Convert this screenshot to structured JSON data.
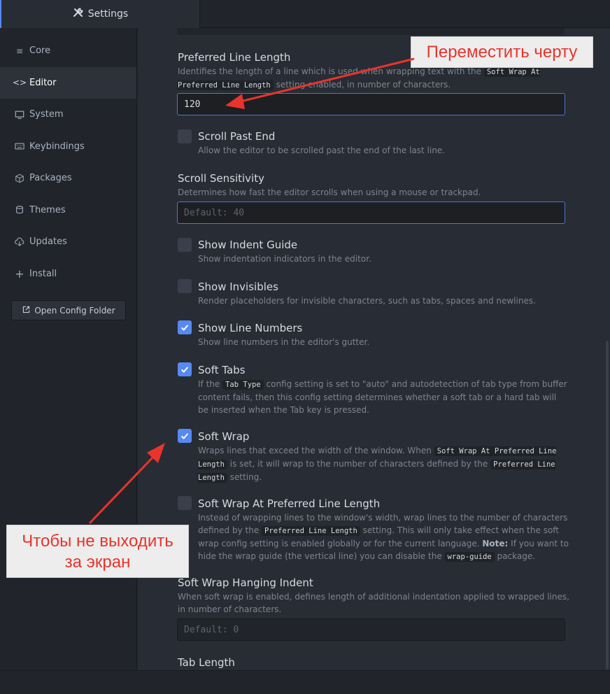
{
  "tab": {
    "label": "Settings"
  },
  "sidebar": {
    "items": [
      {
        "label": "Core",
        "icon": "sliders-icon"
      },
      {
        "label": "Editor",
        "icon": "code-icon"
      },
      {
        "label": "System",
        "icon": "monitor-icon"
      },
      {
        "label": "Keybindings",
        "icon": "keyboard-icon"
      },
      {
        "label": "Packages",
        "icon": "package-icon"
      },
      {
        "label": "Themes",
        "icon": "paintcan-icon"
      },
      {
        "label": "Updates",
        "icon": "cloud-download-icon"
      },
      {
        "label": "Install",
        "icon": "plus-icon"
      }
    ],
    "open_config": "Open Config Folder"
  },
  "settings": {
    "preferred_line_length": {
      "title": "Preferred Line Length",
      "desc_1": "Identifies the length of a line which is used when wrapping text with the",
      "code": "Soft Wrap At Preferred Line Length",
      "desc_2": "setting enabled, in number of characters.",
      "value": "120"
    },
    "scroll_past_end": {
      "title": "Scroll Past End",
      "desc": "Allow the editor to be scrolled past the end of the last line.",
      "checked": false
    },
    "scroll_sensitivity": {
      "title": "Scroll Sensitivity",
      "desc": "Determines how fast the editor scrolls when using a mouse or trackpad.",
      "placeholder": "Default: 40"
    },
    "show_indent_guide": {
      "title": "Show Indent Guide",
      "desc": "Show indentation indicators in the editor.",
      "checked": false
    },
    "show_invisibles": {
      "title": "Show Invisibles",
      "desc": "Render placeholders for invisible characters, such as tabs, spaces and newlines.",
      "checked": false
    },
    "show_line_numbers": {
      "title": "Show Line Numbers",
      "desc": "Show line numbers in the editor's gutter.",
      "checked": true
    },
    "soft_tabs": {
      "title": "Soft Tabs",
      "desc_1": "If the",
      "code": "Tab Type",
      "desc_2": "config setting is set to \"auto\" and autodetection of tab type from buffer content fails, then this config setting determines whether a soft tab or a hard tab will be inserted when the Tab key is pressed.",
      "checked": true
    },
    "soft_wrap": {
      "title": "Soft Wrap",
      "desc_1": "Wraps lines that exceed the width of the window. When",
      "code_1": "Soft Wrap At Preferred Line Length",
      "desc_2": "is set, it will wrap to the number of characters defined by the",
      "code_2": "Preferred Line Length",
      "desc_3": "setting.",
      "checked": true
    },
    "soft_wrap_at_pll": {
      "title": "Soft Wrap At Preferred Line Length",
      "desc_1": "Instead of wrapping lines to the window's width, wrap lines to the number of characters defined by the",
      "code_1": "Preferred Line Length",
      "desc_2": "setting. This will only take effect when the soft wrap config setting is enabled globally or for the current language.",
      "note_label": "Note:",
      "desc_3": "If you want to hide the wrap guide (the vertical line) you can disable the",
      "code_2": "wrap-guide",
      "desc_4": "package.",
      "checked": false
    },
    "soft_wrap_hanging_indent": {
      "title": "Soft Wrap Hanging Indent",
      "desc": "When soft wrap is enabled, defines length of additional indentation applied to wrapped lines, in number of characters.",
      "placeholder": "Default: 0"
    },
    "tab_length": {
      "title": "Tab Length"
    }
  },
  "annotations": {
    "top": "Переместить черту",
    "bottom_1": "Чтобы не выходить",
    "bottom_2": "за экран",
    "color": "#e8342c"
  },
  "colors": {
    "accent": "#568af2",
    "background": "#282c34",
    "sidebar": "#21252b"
  }
}
